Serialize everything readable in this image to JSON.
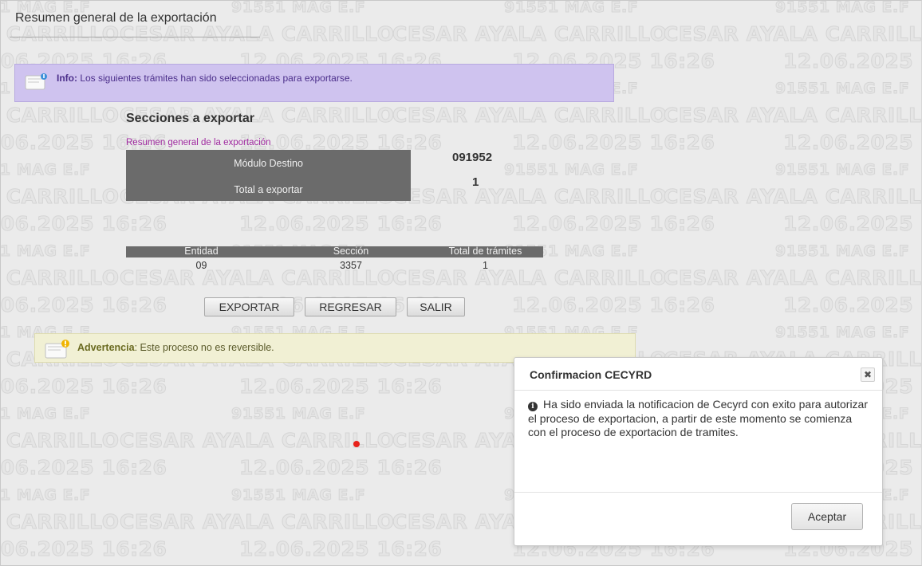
{
  "page": {
    "title": "Resumen general de la exportación"
  },
  "info": {
    "label": "Info:",
    "text": " Los siguientes trámites han sido seleccionadas para exportarse."
  },
  "sections": {
    "title": "Secciones a exportar",
    "link": "Resumen general de la exportación",
    "modulo_label": "Módulo Destino",
    "modulo_value": "091952",
    "total_label": "Total a exportar",
    "total_value": "1"
  },
  "table": {
    "headers": [
      "Entidad",
      "Sección",
      "Total de trámites"
    ],
    "rows": [
      [
        "09",
        "3357",
        "1"
      ]
    ]
  },
  "buttons": {
    "exportar": "EXPORTAR",
    "regresar": "REGRESAR",
    "salir": "SALIR"
  },
  "warning": {
    "label": "Advertencia",
    "text": ": Este proceso no es reversible."
  },
  "watermark": {
    "name": "CESAR AYALA CARRILLO",
    "datetime": "12.06.2025 16:26",
    "code": "91551 MAG E.F"
  },
  "modal": {
    "title": "Confirmacion CECYRD",
    "close_glyph": "✖",
    "info_glyph": "i",
    "message": "Ha sido enviada la notificacion de Cecyrd con exito para autorizar el proceso de exportacion, a partir de este momento se comienza con el proceso de exportacion de tramites.",
    "accept": "Aceptar"
  },
  "colors": {
    "background": "#ebebeb",
    "info_bg": "#cfc3ef",
    "warning_bg": "#f1f0d4",
    "header_bar": "#6b6b6b",
    "link": "#a02aa0",
    "marker": "#e8221b"
  },
  "icons": {
    "info": "speech-bubble-icon",
    "warning": "speech-bubble-warning-icon",
    "close": "close-icon"
  }
}
